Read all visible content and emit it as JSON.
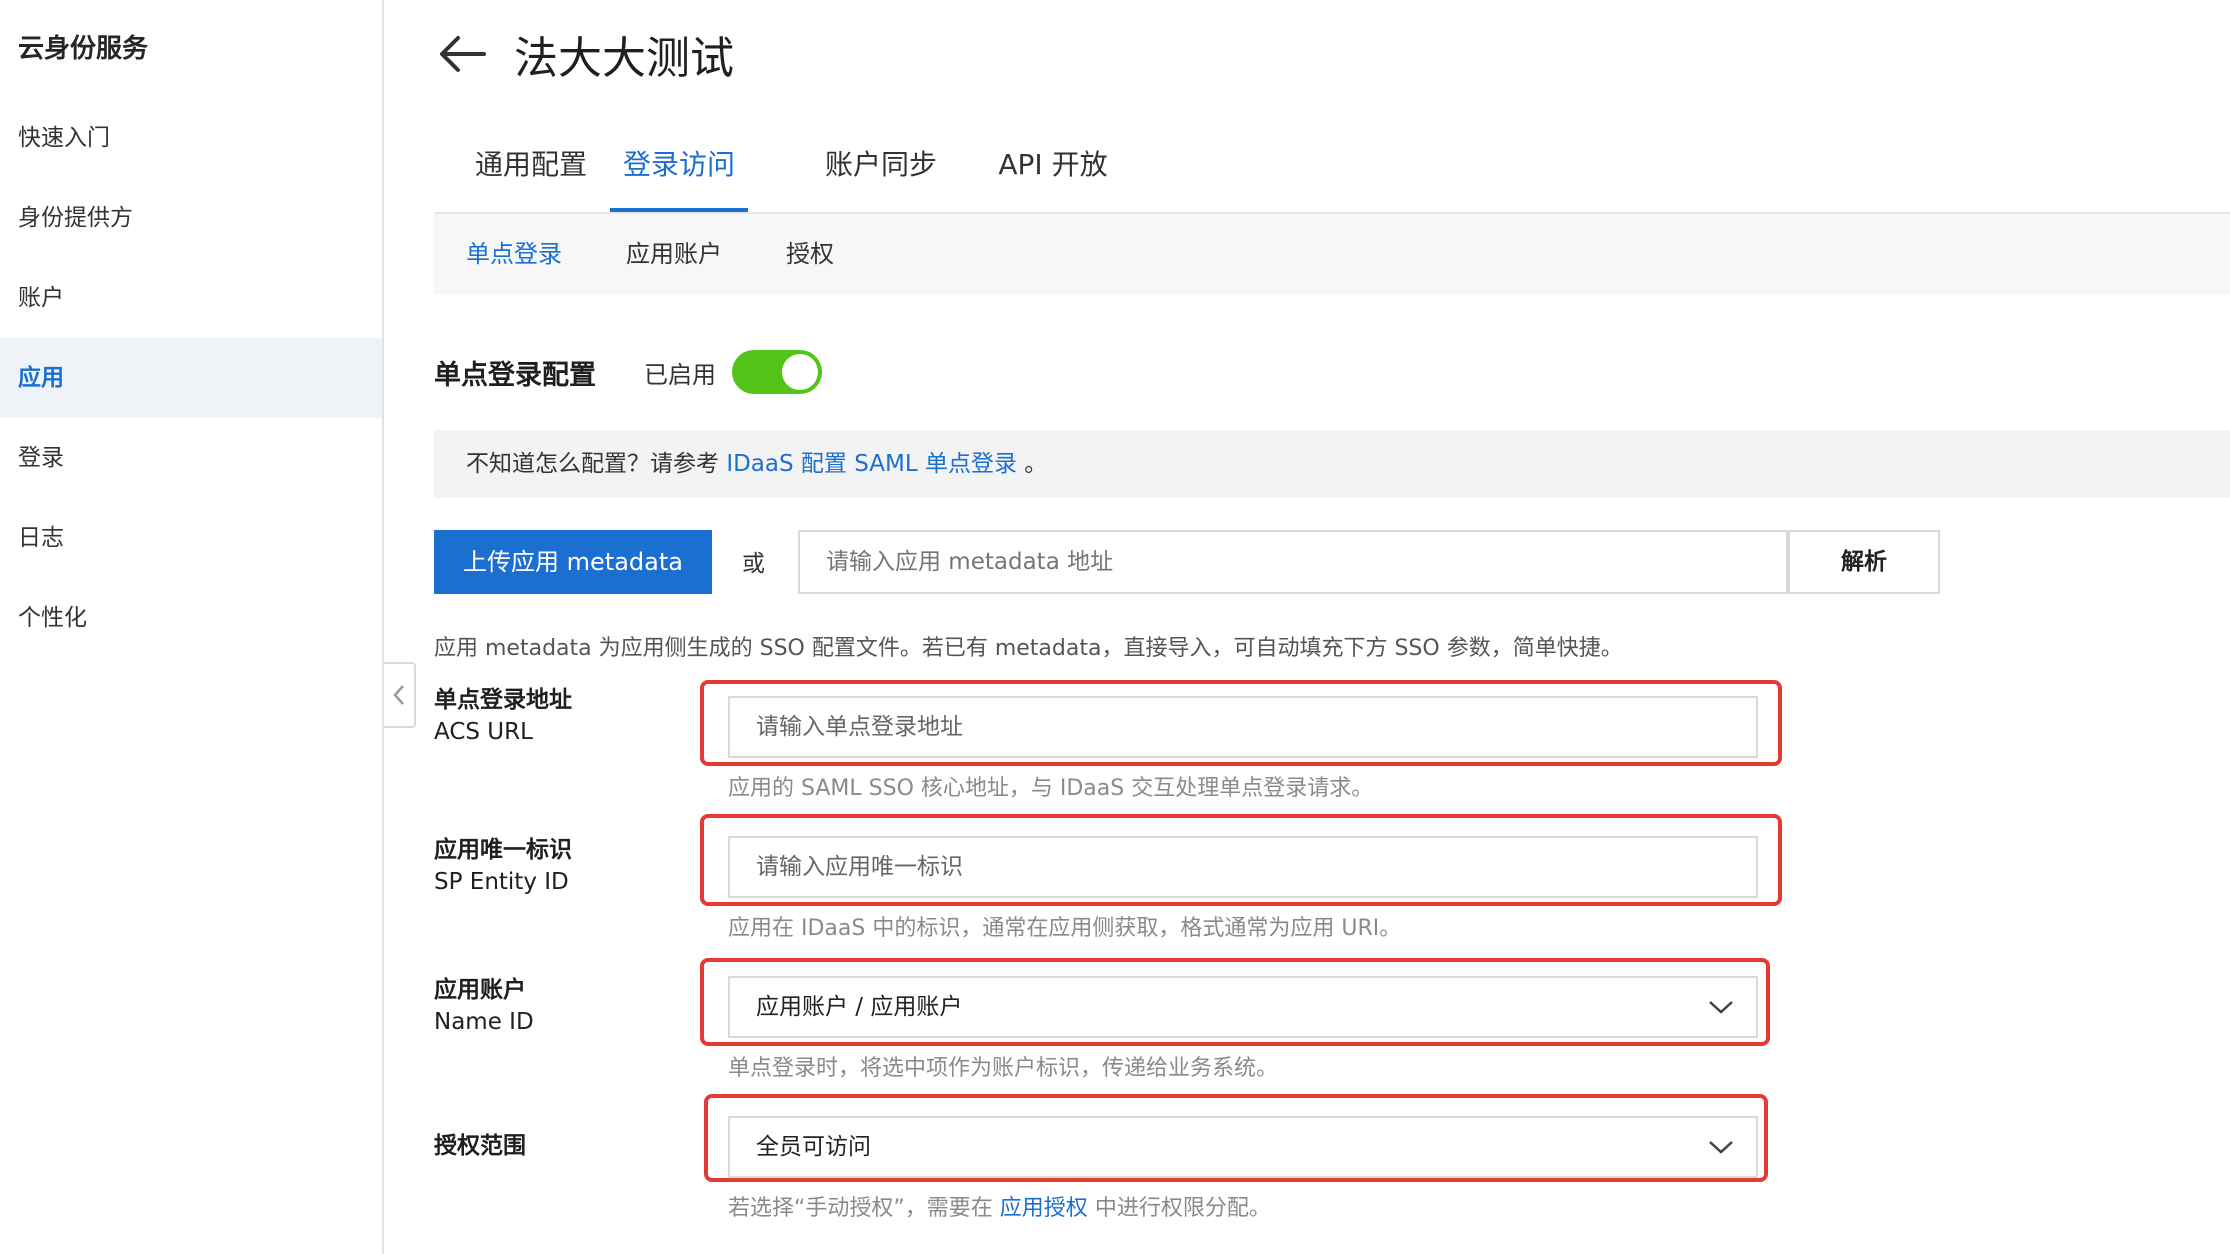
{
  "sidebar": {
    "title": "云身份服务",
    "items": [
      {
        "label": "快速入门"
      },
      {
        "label": "身份提供方"
      },
      {
        "label": "账户"
      },
      {
        "label": "应用"
      },
      {
        "label": "登录"
      },
      {
        "label": "日志"
      },
      {
        "label": "个性化"
      }
    ]
  },
  "header": {
    "title": "法大大测试"
  },
  "tabs": [
    {
      "label": "通用配置"
    },
    {
      "label": "登录访问"
    },
    {
      "label": "账户同步"
    },
    {
      "label": "API 开放"
    }
  ],
  "subtabs": [
    {
      "label": "单点登录"
    },
    {
      "label": "应用账户"
    },
    {
      "label": "授权"
    }
  ],
  "sso": {
    "label": "单点登录配置",
    "status": "已启用",
    "enabled": true
  },
  "notice": {
    "prefix": "不知道怎么配置？请参考",
    "link": "IDaaS 配置 SAML 单点登录",
    "suffix": "。"
  },
  "metadata": {
    "upload_label": "上传应用 metadata",
    "or": "或",
    "placeholder": "请输入应用 metadata 地址",
    "parse_label": "解析",
    "help": "应用 metadata 为应用侧生成的 SSO 配置文件。若已有 metadata，直接导入，可自动填充下方 SSO 参数，简单快捷。"
  },
  "fields": {
    "acs": {
      "label_zh": "单点登录地址",
      "label_en": "ACS URL",
      "placeholder": "请输入单点登录地址",
      "help": "应用的 SAML SSO 核心地址，与 IDaaS 交互处理单点登录请求。"
    },
    "entity": {
      "label_zh": "应用唯一标识",
      "label_en": "SP Entity ID",
      "placeholder": "请输入应用唯一标识",
      "help": "应用在 IDaaS 中的标识，通常在应用侧获取，格式通常为应用 URI。"
    },
    "nameid": {
      "label_zh": "应用账户",
      "label_en": "Name ID",
      "value": "应用账户 / 应用账户",
      "help": "单点登录时，将选中项作为账户标识，传递给业务系统。"
    },
    "scope": {
      "label_zh": "授权范围",
      "value": "全员可访问",
      "help_prefix": "若选择“手动授权”，需要在",
      "help_link": "应用授权",
      "help_suffix": "中进行权限分配。"
    }
  },
  "colors": {
    "accent": "#1b6fd1",
    "toggle_on": "#52c41a",
    "highlight": "#e53935"
  }
}
